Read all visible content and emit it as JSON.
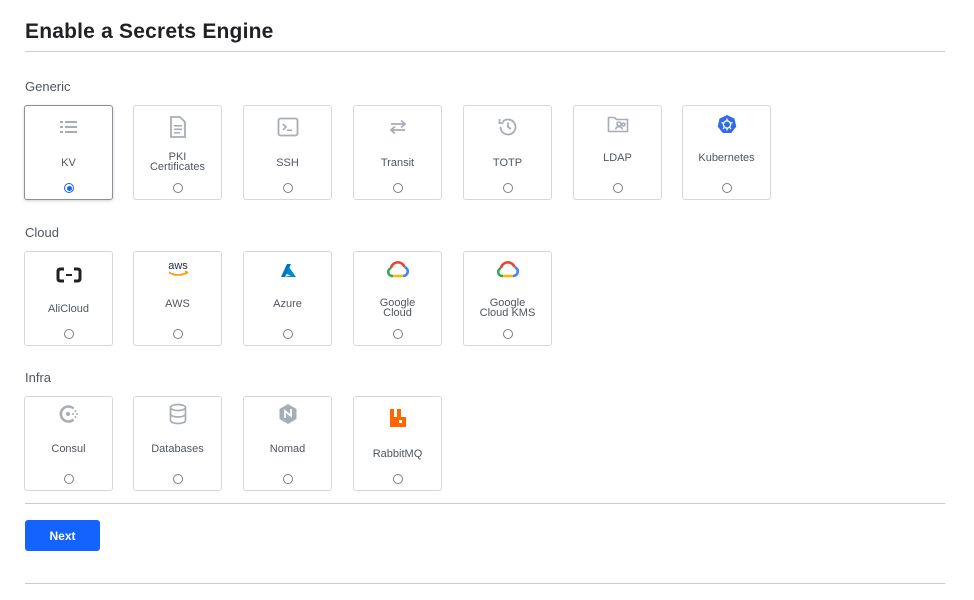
{
  "page": {
    "title": "Enable a Secrets Engine"
  },
  "sections": {
    "generic": {
      "label": "Generic",
      "tiles": [
        {
          "name": "KV",
          "icon": "list-icon",
          "selected": true
        },
        {
          "name": "PKI\nCertificates",
          "icon": "document-icon",
          "selected": false
        },
        {
          "name": "SSH",
          "icon": "terminal-icon",
          "selected": false
        },
        {
          "name": "Transit",
          "icon": "arrows-swap-icon",
          "selected": false
        },
        {
          "name": "TOTP",
          "icon": "history-icon",
          "selected": false
        },
        {
          "name": "LDAP",
          "icon": "folder-users-icon",
          "selected": false
        },
        {
          "name": "Kubernetes",
          "icon": "kubernetes-icon",
          "selected": false
        }
      ]
    },
    "cloud": {
      "label": "Cloud",
      "tiles": [
        {
          "name": "AliCloud",
          "icon": "alicloud-icon",
          "selected": false
        },
        {
          "name": "AWS",
          "icon": "aws-icon",
          "selected": false
        },
        {
          "name": "Azure",
          "icon": "azure-icon",
          "selected": false
        },
        {
          "name": "Google\nCloud",
          "icon": "google-cloud-icon",
          "selected": false
        },
        {
          "name": "Google\nCloud KMS",
          "icon": "google-cloud-kms-icon",
          "selected": false
        }
      ]
    },
    "infra": {
      "label": "Infra",
      "tiles": [
        {
          "name": "Consul",
          "icon": "consul-icon",
          "selected": false
        },
        {
          "name": "Databases",
          "icon": "database-icon",
          "selected": false
        },
        {
          "name": "Nomad",
          "icon": "nomad-icon",
          "selected": false
        },
        {
          "name": "RabbitMQ",
          "icon": "rabbitmq-icon",
          "selected": false
        }
      ]
    }
  },
  "actions": {
    "next_label": "Next"
  },
  "colors": {
    "accent": "#1563ff",
    "text": "#1f2124",
    "muted": "#4f565e",
    "border": "#d5d9de"
  }
}
